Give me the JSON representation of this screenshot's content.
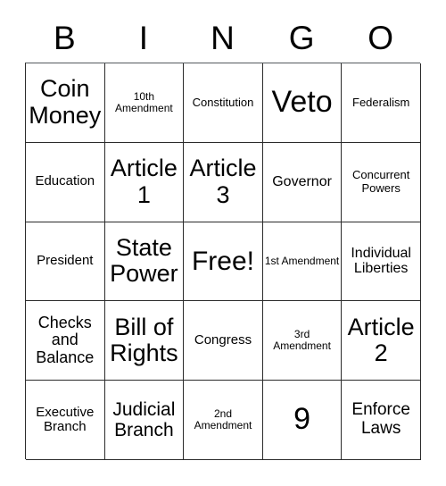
{
  "card": {
    "header_letters": [
      "B",
      "I",
      "N",
      "G",
      "O"
    ],
    "rows": [
      [
        {
          "label": "Coin Money",
          "size": "fs-xxl"
        },
        {
          "label": "10th Amendment",
          "size": "fs-xxs"
        },
        {
          "label": "Constitution",
          "size": "fs-xs"
        },
        {
          "label": "Veto",
          "size": "fs-h2"
        },
        {
          "label": "Federalism",
          "size": "fs-xs"
        }
      ],
      [
        {
          "label": "Education",
          "size": "fs-s"
        },
        {
          "label": "Article 1",
          "size": "fs-xxl"
        },
        {
          "label": "Article 3",
          "size": "fs-xxl"
        },
        {
          "label": "Governor",
          "size": "fs-sm"
        },
        {
          "label": "Concurrent Powers",
          "size": "fs-xs"
        }
      ],
      [
        {
          "label": "President",
          "size": "fs-s"
        },
        {
          "label": "State Power",
          "size": "fs-xxl"
        },
        {
          "label": "Free!",
          "size": "fs-h1"
        },
        {
          "label": "1st Amendment",
          "size": "fs-xxs"
        },
        {
          "label": "Individual Liberties",
          "size": "fs-sm"
        }
      ],
      [
        {
          "label": "Checks and Balance",
          "size": "fs-m"
        },
        {
          "label": "Bill of Rights",
          "size": "fs-xxl"
        },
        {
          "label": "Congress",
          "size": "fs-s"
        },
        {
          "label": "3rd Amendment",
          "size": "fs-xxs"
        },
        {
          "label": "Article 2",
          "size": "fs-xxl"
        }
      ],
      [
        {
          "label": "Executive Branch",
          "size": "fs-s"
        },
        {
          "label": "Judicial Branch",
          "size": "fs-l"
        },
        {
          "label": "2nd Amendment",
          "size": "fs-xxs"
        },
        {
          "label": "9",
          "size": "fs-h2"
        },
        {
          "label": "Enforce Laws",
          "size": "fs-ml"
        }
      ]
    ]
  },
  "colors": {
    "border": "#2b2b2b",
    "text": "#000000",
    "background": "#ffffff"
  }
}
